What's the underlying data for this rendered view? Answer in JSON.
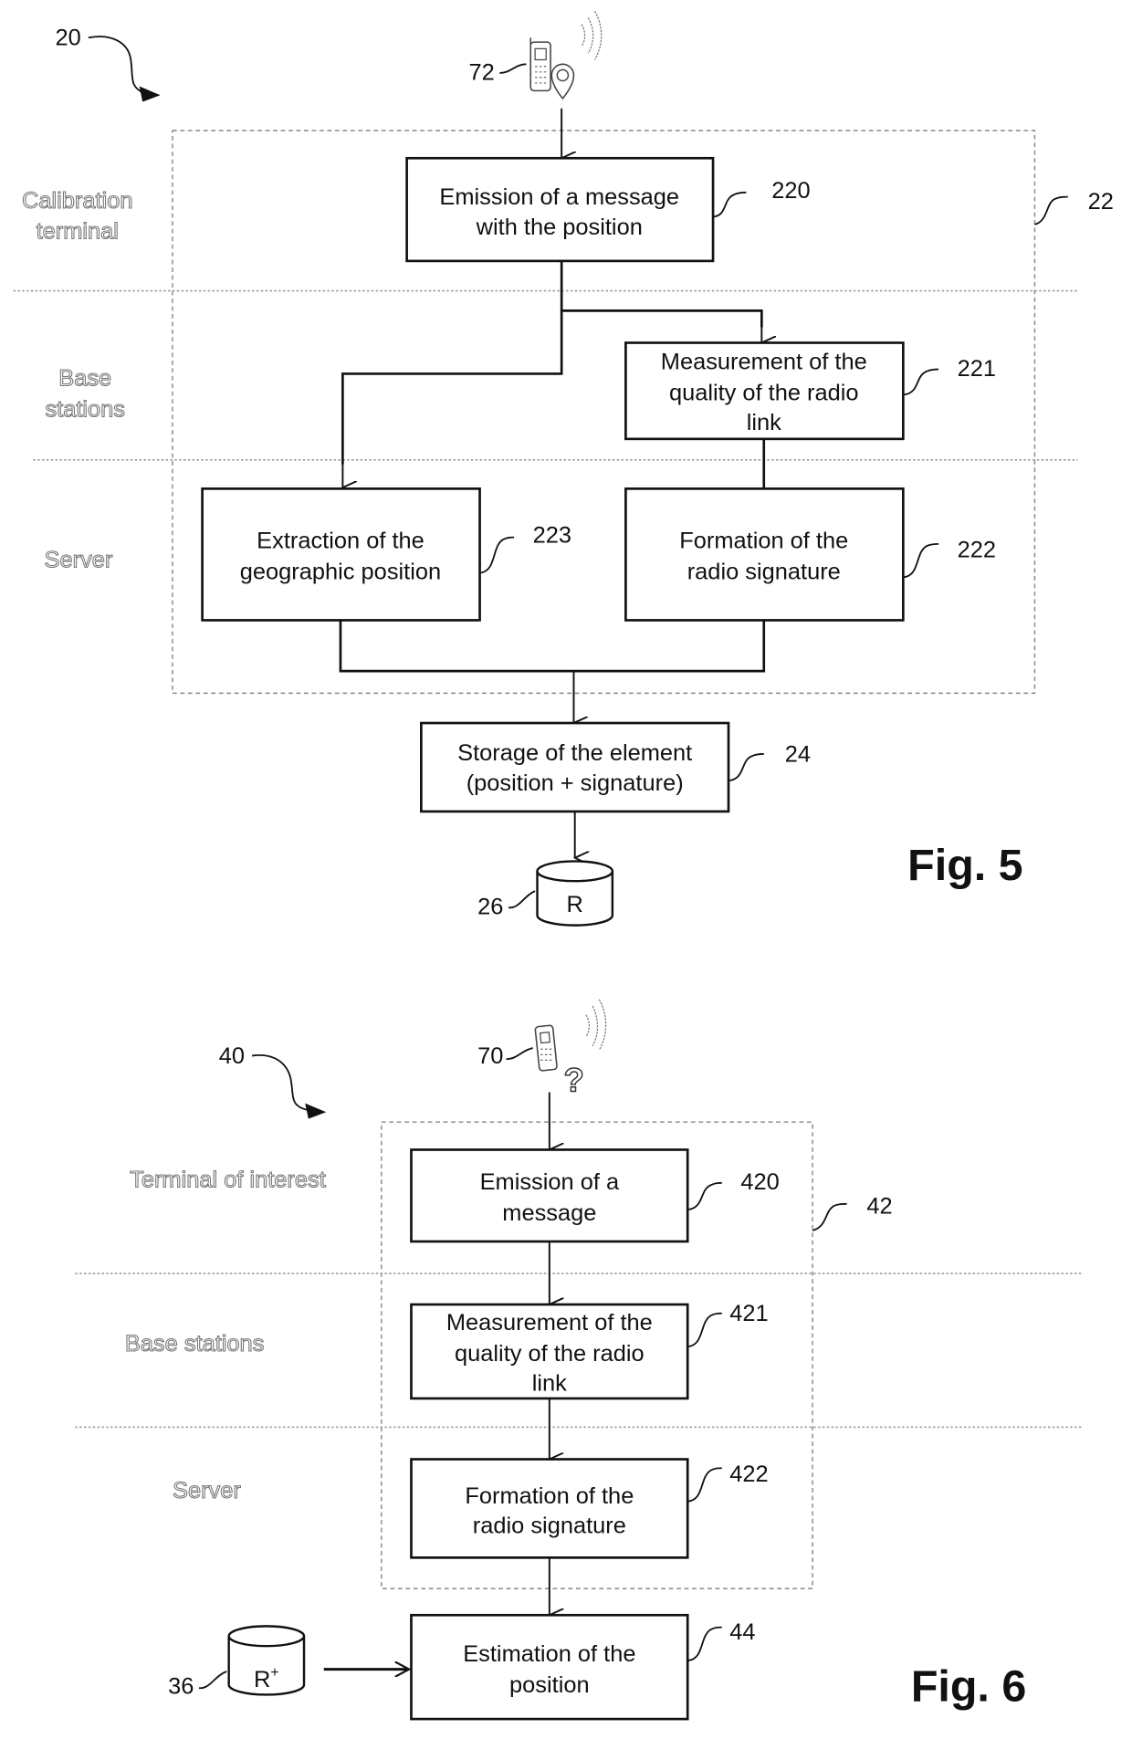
{
  "fig5": {
    "ref_process": "20",
    "ref_container": "22",
    "lanes": [
      "Calibration",
      "terminal",
      "Base",
      "stations",
      "Server"
    ],
    "device": {
      "ref": "72",
      "icon": "phone-with-location-pin-icon"
    },
    "boxes": {
      "emission": {
        "ref": "220",
        "lines": [
          "Emission of a message",
          "with the position"
        ]
      },
      "measurement": {
        "ref": "221",
        "lines": [
          "Measurement of the",
          "quality of the radio",
          "link"
        ]
      },
      "formation": {
        "ref": "222",
        "lines": [
          "Formation of the",
          "radio signature"
        ]
      },
      "extraction": {
        "ref": "223",
        "lines": [
          "Extraction of the",
          "geographic position"
        ]
      },
      "storage": {
        "ref": "24",
        "lines": [
          "Storage of the element",
          "(position + signature)"
        ]
      }
    },
    "database": {
      "ref": "26",
      "label": "R"
    },
    "caption": "Fig. 5"
  },
  "fig6": {
    "ref_process": "40",
    "ref_container": "42",
    "lanes": [
      "Terminal of interest",
      "Base stations",
      "Server"
    ],
    "device": {
      "ref": "70",
      "icon": "phone-with-question-mark-icon"
    },
    "boxes": {
      "emission": {
        "ref": "420",
        "lines": [
          "Emission of a",
          "message"
        ]
      },
      "measurement": {
        "ref": "421",
        "lines": [
          "Measurement of the",
          "quality of the radio",
          "link"
        ]
      },
      "formation": {
        "ref": "422",
        "lines": [
          "Formation of the",
          "radio signature"
        ]
      },
      "estimation": {
        "ref": "44",
        "lines": [
          "Estimation of the",
          "position"
        ]
      }
    },
    "database": {
      "ref": "36",
      "label": "R",
      "label_sup": "+"
    },
    "caption": "Fig. 6"
  }
}
